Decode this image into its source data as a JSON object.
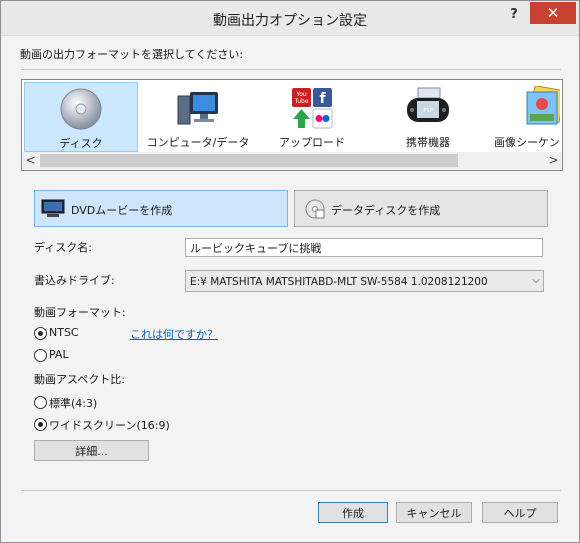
{
  "window": {
    "title": "動画出力オプション設定",
    "help_glyph": "?",
    "close_glyph": "✕"
  },
  "prompt": "動画の出力フォーマットを選択してください:",
  "formats": [
    {
      "label": "ディスク",
      "icon": "disc-icon",
      "selected": true
    },
    {
      "label": "コンピュータ/データ",
      "icon": "computer-icon",
      "selected": false
    },
    {
      "label": "アップロード",
      "icon": "upload-icon",
      "selected": false
    },
    {
      "label": "携帯機器",
      "icon": "portable-device-icon",
      "selected": false
    },
    {
      "label": "画像シーケンス",
      "icon": "image-sequence-icon",
      "selected": false
    }
  ],
  "scrollbar": {
    "left": "<",
    "right": ">"
  },
  "mode_buttons": {
    "dvd": "DVDムービーを作成",
    "data": "データディスクを作成",
    "dvd_selected": true
  },
  "disc_name": {
    "label": "ディスク名:",
    "value": "ルービックキューブに挑戦"
  },
  "drive": {
    "label": "書込みドライブ:",
    "value": "E:¥ MATSHITA MATSHITABD-MLT SW-5584  1.0208121200"
  },
  "video_format": {
    "label": "動画フォーマット:",
    "options": [
      "NTSC",
      "PAL"
    ],
    "selected": "NTSC",
    "help_link": "これは何ですか？"
  },
  "aspect": {
    "label": "動画アスペクト比:",
    "options": [
      "標準(4:3)",
      "ワイドスクリーン(16:9)"
    ],
    "selected": "ワイドスクリーン(16:9)"
  },
  "details_button": "詳細...",
  "footer": {
    "create": "作成",
    "cancel": "キャンセル",
    "help": "ヘルプ"
  },
  "colors": {
    "accent": "#cce8ff",
    "close": "#c7432f",
    "link": "#0066cc"
  }
}
